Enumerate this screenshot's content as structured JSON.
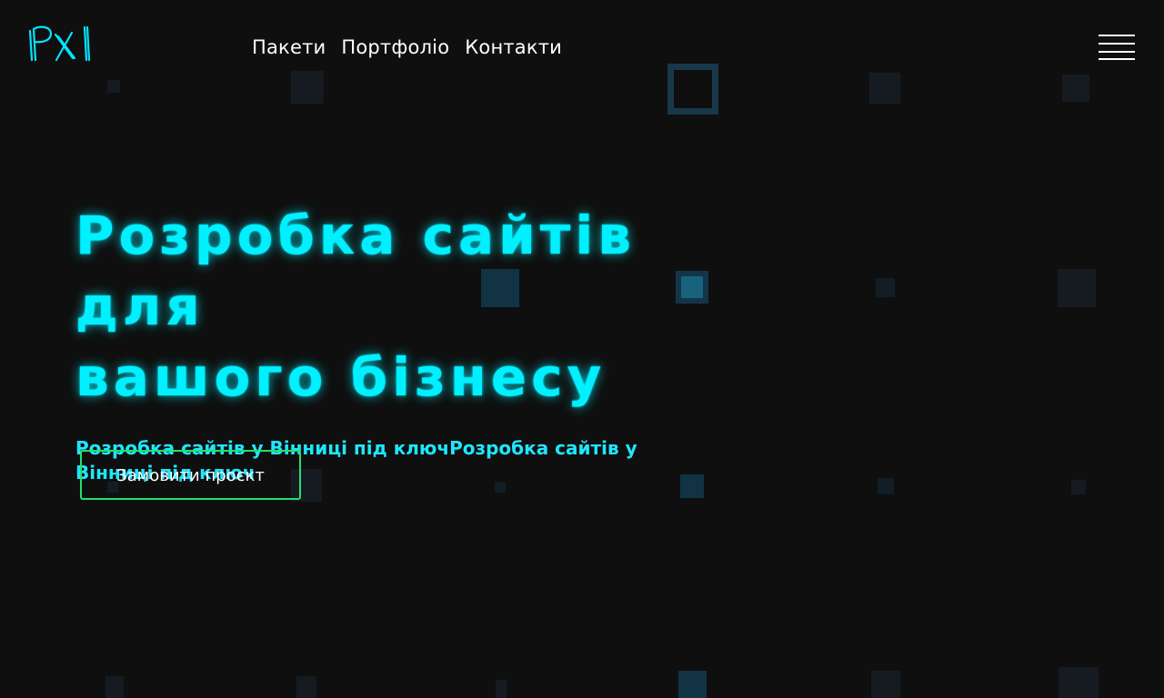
{
  "brand": {
    "logo_text": "PXI",
    "accent_color": "#00f0ff",
    "cta_border_color": "#22e070"
  },
  "nav": {
    "items": [
      {
        "label": "Пакети"
      },
      {
        "label": "Портфоліо"
      },
      {
        "label": "Контакти"
      }
    ],
    "menu_icon": "hamburger-menu-icon"
  },
  "hero": {
    "title_line1": "Розробка сайтів для",
    "title_line2": "вашого бізнесу",
    "subtitle": "Розробка сайтів у Вінниці під ключРозробка сайтів у Вінниці під ключ",
    "cta_label": "Замовити проєкт"
  }
}
